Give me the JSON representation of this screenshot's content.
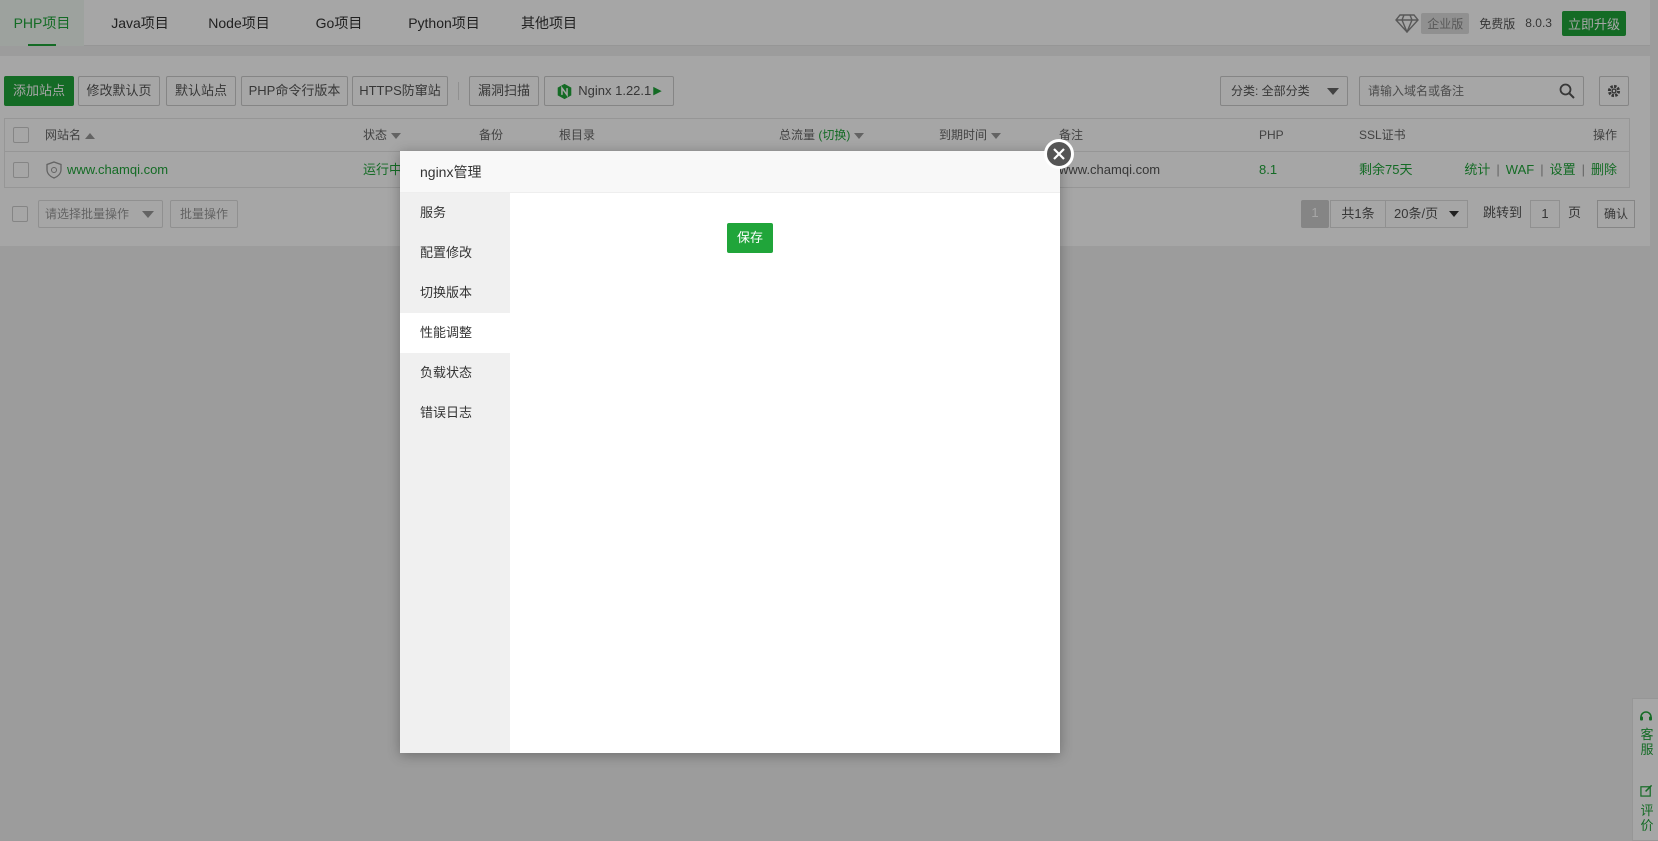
{
  "tabs": [
    {
      "label": "PHP项目",
      "active": true
    },
    {
      "label": "Java项目"
    },
    {
      "label": "Node项目"
    },
    {
      "label": "Go项目"
    },
    {
      "label": "Python项目"
    },
    {
      "label": "其他项目"
    }
  ],
  "header_right": {
    "edition_badge": "企业版",
    "free_label": "免费版",
    "version": "8.0.3",
    "upgrade_label": "立即升级"
  },
  "toolbar": {
    "add_site": "添加站点",
    "edit_default_page": "修改默认页",
    "default_site": "默认站点",
    "php_cli_version": "PHP命令行版本",
    "https_anti_redirect": "HTTPS防窜站",
    "vuln_scan": "漏洞扫描",
    "nginx_label": "Nginx 1.22.1",
    "category_select": "分类: 全部分类",
    "search_placeholder": "请输入域名或备注"
  },
  "table": {
    "headers": {
      "site_name": "网站名",
      "status": "状态",
      "backup": "备份",
      "root_dir": "根目录",
      "total_traffic": "总流量",
      "traffic_switch": "(切换)",
      "expire": "到期时间",
      "remark": "备注",
      "php": "PHP",
      "ssl": "SSL证书",
      "actions": "操作"
    },
    "rows": [
      {
        "site_name": "www.chamqi.com",
        "status": "运行中",
        "remark": "www.chamqi.com",
        "php": "8.1",
        "ssl": "剩余75天",
        "action_stats": "统计",
        "action_waf": "WAF",
        "action_settings": "设置",
        "action_delete": "删除"
      }
    ]
  },
  "footer": {
    "batch_placeholder": "请选择批量操作",
    "batch_button": "批量操作",
    "page_current": "1",
    "page_total": "共1条",
    "page_size": "20条/页",
    "jump_label": "跳转到",
    "jump_value": "1",
    "page_unit": "页",
    "confirm": "确认"
  },
  "side_float": {
    "service_label": "客服",
    "review_label": "评价"
  },
  "modal": {
    "title": "nginx管理",
    "menu": [
      {
        "label": "服务"
      },
      {
        "label": "配置修改"
      },
      {
        "label": "切换版本"
      },
      {
        "label": "性能调整",
        "active": true
      },
      {
        "label": "负载状态"
      },
      {
        "label": "错误日志"
      }
    ],
    "save_label": "保存"
  },
  "colors": {
    "accent": "#20a53a",
    "overlay": "rgba(0,0,0,0.35)"
  }
}
